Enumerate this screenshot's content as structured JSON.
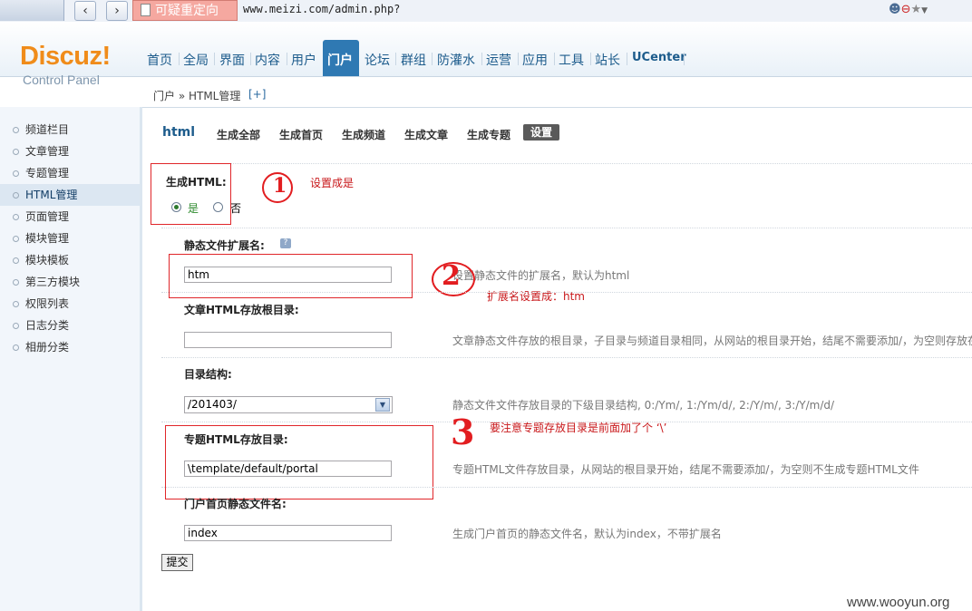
{
  "browser": {
    "redirect_label": "可疑重定向",
    "url": "www.meizi.com/admin.php?"
  },
  "logo": {
    "title": "Discuz!",
    "subtitle": "Control Panel"
  },
  "top_nav": {
    "items": [
      "首页",
      "全局",
      "界面",
      "内容",
      "用户",
      "门户",
      "论坛",
      "群组",
      "防灌水",
      "运营",
      "应用",
      "工具",
      "站长",
      "UCenter"
    ],
    "active": "门户"
  },
  "breadcrumb": {
    "path": "门户 » HTML管理",
    "add": "[+]"
  },
  "sidebar": {
    "items": [
      "频道栏目",
      "文章管理",
      "专题管理",
      "HTML管理",
      "页面管理",
      "模块管理",
      "模块模板",
      "第三方模块",
      "权限列表",
      "日志分类",
      "相册分类"
    ],
    "active": "HTML管理"
  },
  "page": {
    "title": "html",
    "tabs": [
      "生成全部",
      "生成首页",
      "生成频道",
      "生成文章",
      "生成专题",
      "设置"
    ],
    "active_tab": "设置"
  },
  "form": {
    "generate_html": {
      "label": "生成HTML:",
      "yes": "是",
      "no": "否",
      "selected": "是"
    },
    "ext": {
      "label": "静态文件扩展名:",
      "value": "htm",
      "hint": "静态文件的扩展名，默认为html",
      "hint_prefix": "设置"
    },
    "article_dir": {
      "label": "文章HTML存放根目录:",
      "value": "",
      "hint": "文章静态文件存放的根目录，子目录与频道目录相同，从网站的根目录开始，结尾不需要添加/，为空则存放在"
    },
    "dir_structure": {
      "label": "目录结构:",
      "value": "/201403/",
      "hint": "静态文件文件存放目录的下级目录结构, 0:/Ym/, 1:/Ym/d/, 2:/Y/m/, 3:/Y/m/d/"
    },
    "topic_dir": {
      "label": "专题HTML存放目录:",
      "value": "\\template/default/portal",
      "hint": "专题HTML文件存放目录，从网站的根目录开始，结尾不需要添加/，为空则不生成专题HTML文件"
    },
    "index_name": {
      "label": "门户首页静态文件名:",
      "value": "index",
      "hint": "生成门户首页的静态文件名，默认为index，不带扩展名"
    },
    "submit": "提交"
  },
  "annotations": {
    "a1_num": "1",
    "a1_text": "设置成是",
    "a2_num": "2",
    "a2_text": "扩展名设置成：htm",
    "a3_num": "3",
    "a3_text": "要注意专题存放目录是前面加了个 ‘\\’"
  },
  "watermark": "www.wooyun.org"
}
